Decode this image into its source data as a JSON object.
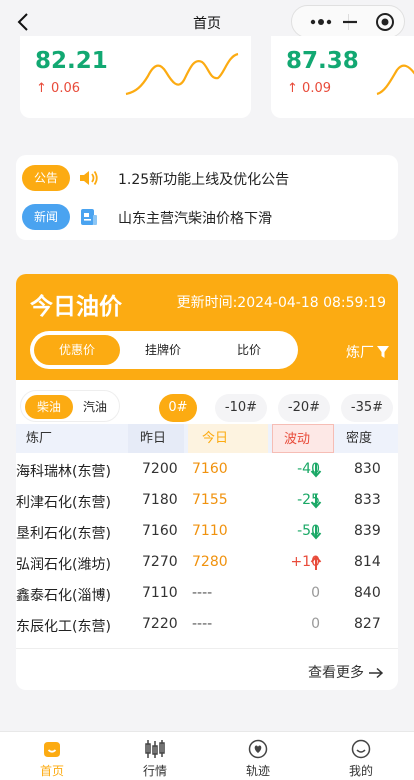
{
  "header": {
    "title": "首页"
  },
  "stats": [
    {
      "value": "82.21",
      "change": "0.06"
    },
    {
      "value": "87.38",
      "change": "0.09"
    }
  ],
  "notices": [
    {
      "tag": "公告",
      "text": "1.25新功能上线及优化公告",
      "tag_color": "#fcab12",
      "icon": "speaker-icon"
    },
    {
      "tag": "新闻",
      "text": "山东主营汽柴油价格下滑",
      "tag_color": "#4aa3f0",
      "icon": "news-icon"
    }
  ],
  "oil": {
    "title": "今日油价",
    "update_label": "更新时间:",
    "update_time": "2024-04-18 08:59:19",
    "price_tabs": [
      "优惠价",
      "挂牌价",
      "比价"
    ],
    "active_price_tab": 0,
    "refinery_filter": "炼厂",
    "fuel_types": [
      "柴油",
      "汽油"
    ],
    "active_fuel": 0,
    "grades": [
      "0#",
      "-10#",
      "-20#",
      "-35#"
    ],
    "active_grade": 0,
    "columns": [
      "炼厂",
      "昨日",
      "今日",
      "波动",
      "密度"
    ],
    "rows": [
      {
        "name": "海科瑞林(东营)",
        "yesterday": "7200",
        "today": "7160",
        "wave": "-40",
        "dir": "down",
        "density": "830"
      },
      {
        "name": "利津石化(东营)",
        "yesterday": "7180",
        "today": "7155",
        "wave": "-25",
        "dir": "down",
        "density": "833"
      },
      {
        "name": "垦利石化(东营)",
        "yesterday": "7160",
        "today": "7110",
        "wave": "-50",
        "dir": "down",
        "density": "839"
      },
      {
        "name": "弘润石化(潍坊)",
        "yesterday": "7270",
        "today": "7280",
        "wave": "+10",
        "dir": "up",
        "density": "814"
      },
      {
        "name": "鑫泰石化(淄博)",
        "yesterday": "7110",
        "today": "----",
        "wave": "0",
        "dir": "flat",
        "density": "840"
      },
      {
        "name": "东辰化工(东营)",
        "yesterday": "7220",
        "today": "----",
        "wave": "0",
        "dir": "flat",
        "density": "827"
      }
    ],
    "more": "查看更多"
  },
  "tabbar": [
    {
      "label": "首页",
      "icon": "home-icon",
      "active": true
    },
    {
      "label": "行情",
      "icon": "candlestick-icon",
      "active": false
    },
    {
      "label": "轨迹",
      "icon": "track-icon",
      "active": false
    },
    {
      "label": "我的",
      "icon": "smile-icon",
      "active": false
    }
  ],
  "colors": {
    "accent": "#fcab12",
    "up": "#e84b3a",
    "down": "#1aa866",
    "stat": "#12a872"
  }
}
